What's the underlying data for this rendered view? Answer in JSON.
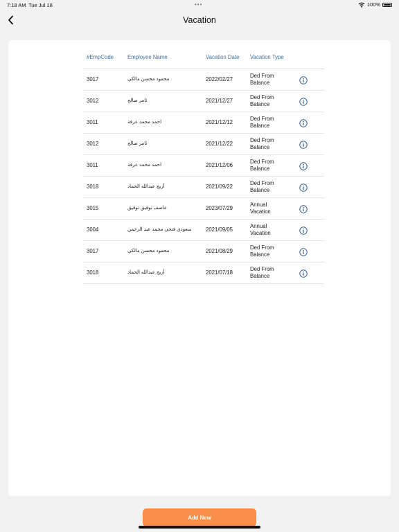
{
  "status_bar": {
    "time": "7:18 AM",
    "date": "Tue Jul 18",
    "battery": "100%",
    "multitask_dots": "•••"
  },
  "header": {
    "title": "Vacation"
  },
  "table": {
    "columns": [
      "#EmpCode",
      "Employee Name",
      "Vacation Date",
      "Vacation Type"
    ],
    "rows": [
      {
        "code": "3017",
        "name": "محمود محسن مالكي",
        "date": "2022/02/27",
        "type_line1": "Ded From",
        "type_line2": "Balance"
      },
      {
        "code": "3012",
        "name": "ثامر صالح",
        "date": "2021/12/27",
        "type_line1": "Ded From",
        "type_line2": "Balance"
      },
      {
        "code": "3011",
        "name": "احمد محمد عرفة",
        "date": "2021/12/12",
        "type_line1": "Ded From",
        "type_line2": "Balance"
      },
      {
        "code": "3012",
        "name": "ثامر صالح",
        "date": "2021/12/22",
        "type_line1": "Ded From",
        "type_line2": "Balance"
      },
      {
        "code": "3011",
        "name": "احمد محمد عرفة",
        "date": "2021/12/06",
        "type_line1": "Ded From",
        "type_line2": "Balance"
      },
      {
        "code": "3018",
        "name": "أريج عبدالله  الحماد",
        "date": "2021/09/22",
        "type_line1": "Ded From",
        "type_line2": "Balance"
      },
      {
        "code": "3015",
        "name": "عاصف توفيق توفيق",
        "date": "2023/07/29",
        "type_line1": "Annual",
        "type_line2": "Vacation"
      },
      {
        "code": "3004",
        "name": "سعودي فتحي محمد عبد الرحمن",
        "date": "2021/09/05",
        "type_line1": "Annual",
        "type_line2": "Vacation"
      },
      {
        "code": "3017",
        "name": "محمود محسن مالكي",
        "date": "2021/08/29",
        "type_line1": "Ded From",
        "type_line2": "Balance"
      },
      {
        "code": "3018",
        "name": "أريج عبدالله  الحماد",
        "date": "2021/07/18",
        "type_line1": "Ded From",
        "type_line2": "Balance"
      }
    ]
  },
  "footer": {
    "add_button_label": "Add New"
  },
  "icons": {
    "back": "chevron-left-icon",
    "info": "info-circle-icon",
    "wifi": "wifi-icon",
    "battery": "battery-icon"
  },
  "colors": {
    "accent": "#fa8f4b",
    "header_text": "#3f6fa0",
    "info_icon": "#2f5f8f"
  }
}
